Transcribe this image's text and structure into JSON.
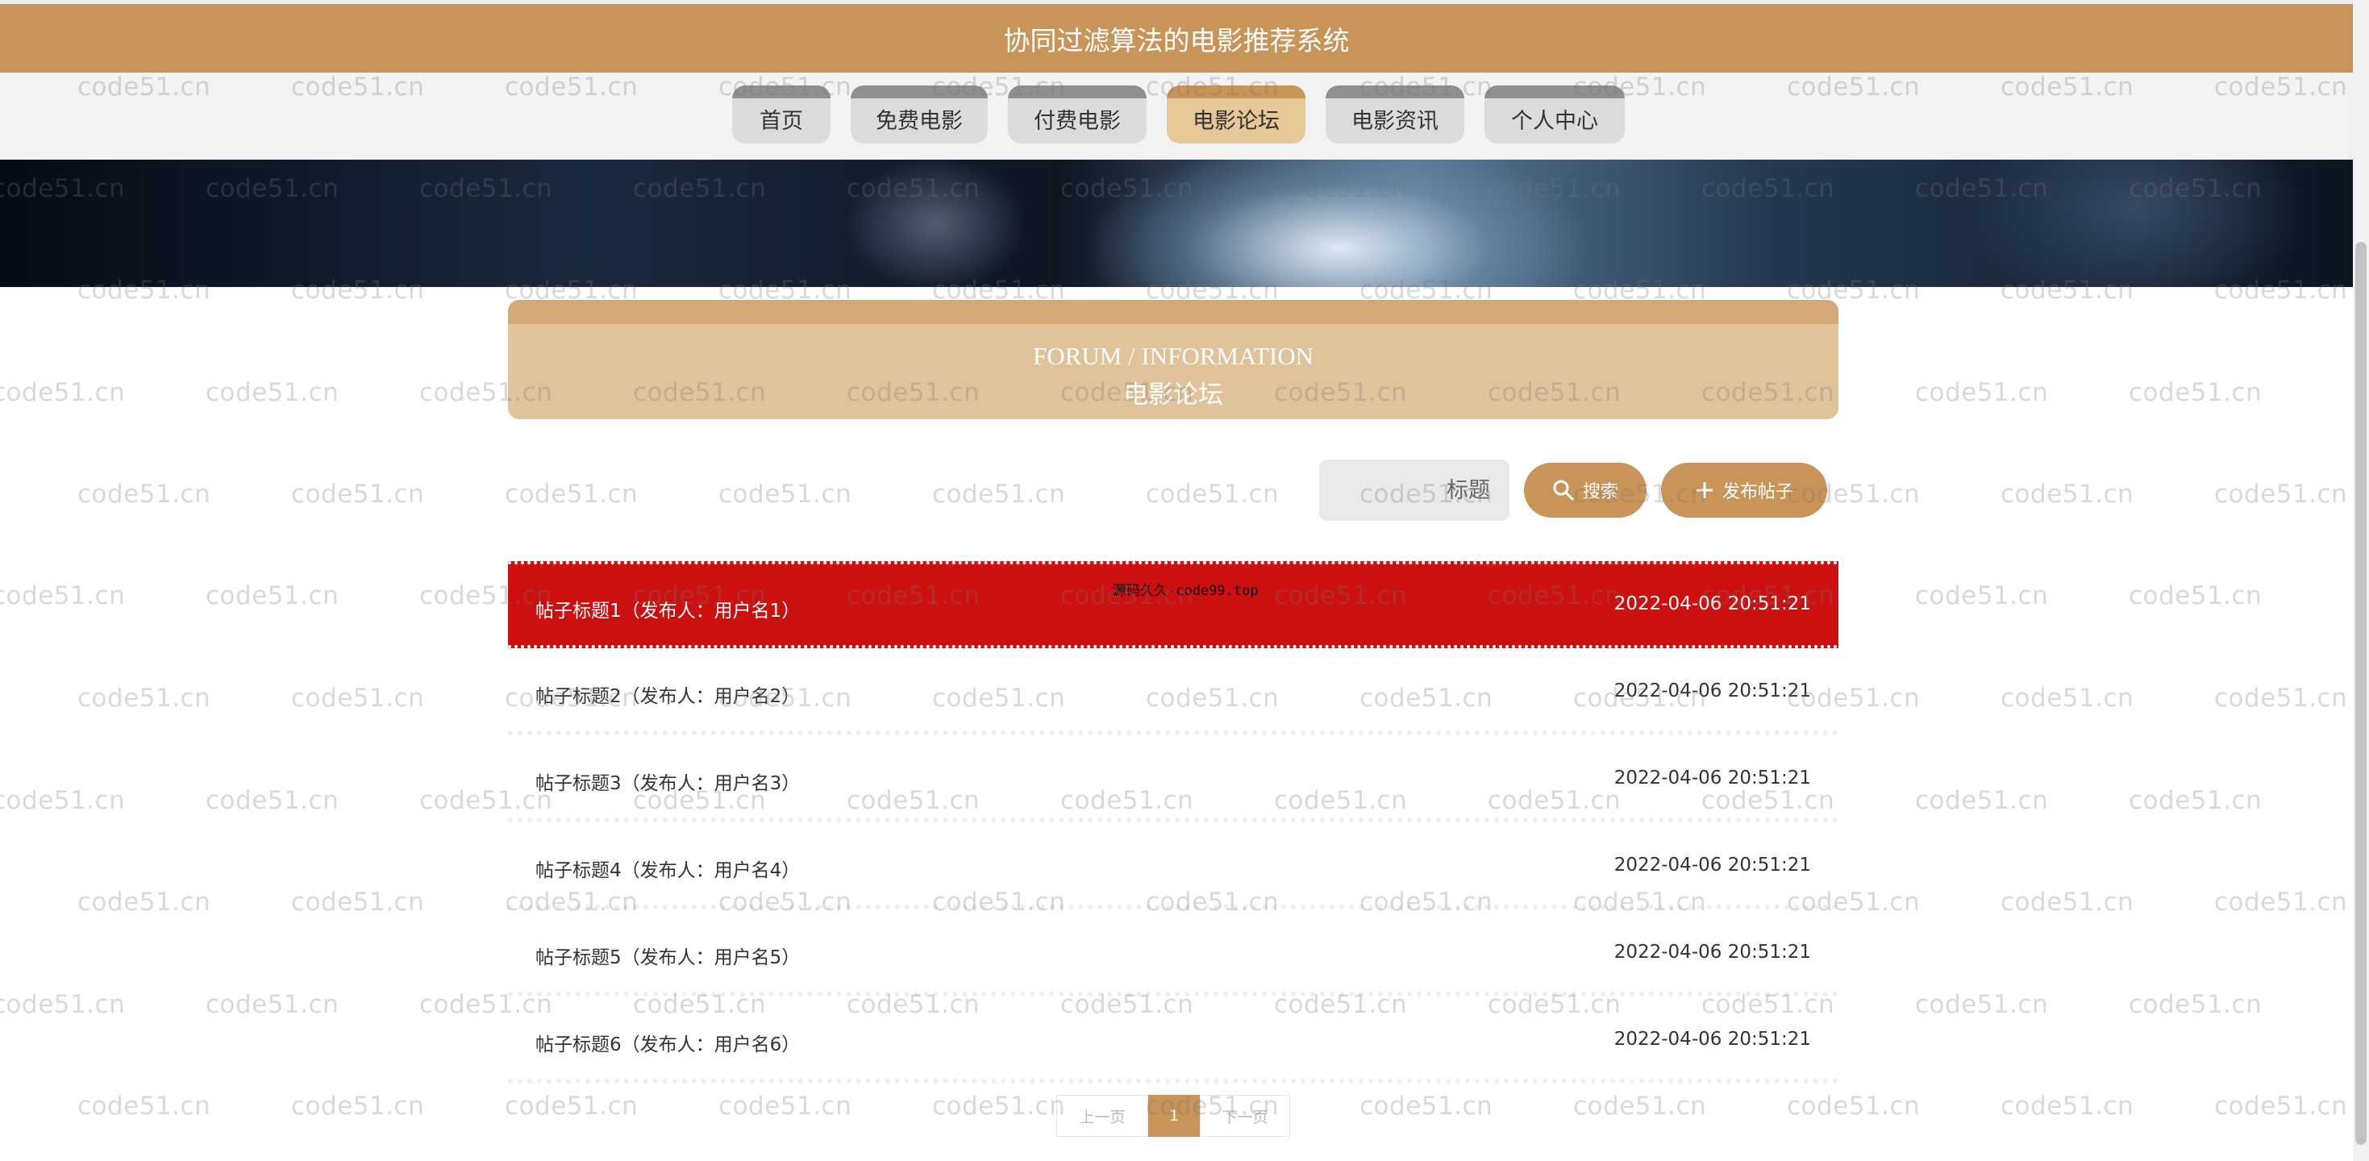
{
  "header": {
    "title": "协同过滤算法的电影推荐系统"
  },
  "nav": {
    "items": [
      {
        "label": "首页"
      },
      {
        "label": "免费电影"
      },
      {
        "label": "付费电影"
      },
      {
        "label": "电影论坛",
        "active": true
      },
      {
        "label": "电影资讯"
      },
      {
        "label": "个人中心"
      }
    ]
  },
  "section": {
    "title_en": "FORUM / INFORMATION",
    "title_cn": "电影论坛"
  },
  "search": {
    "placeholder": "标题",
    "search_label": "搜索",
    "search_icon": "search-icon",
    "publish_label": "发布帖子",
    "publish_icon": "plus-icon"
  },
  "posts": [
    {
      "title": "帖子标题1（发布人：用户名1）",
      "time": "2022-04-06 20:51:21"
    },
    {
      "title": "帖子标题2（发布人：用户名2）",
      "time": "2022-04-06 20:51:21"
    },
    {
      "title": "帖子标题3（发布人：用户名3）",
      "time": "2022-04-06 20:51:21"
    },
    {
      "title": "帖子标题4（发布人：用户名4）",
      "time": "2022-04-06 20:51:21"
    },
    {
      "title": "帖子标题5（发布人：用户名5）",
      "time": "2022-04-06 20:51:21"
    },
    {
      "title": "帖子标题6（发布人：用户名6）",
      "time": "2022-04-06 20:51:21"
    }
  ],
  "overlay_text": "源码久久-code99.top",
  "pagination": {
    "prev": "上一页",
    "current": "1",
    "next": "下一页"
  },
  "watermark": "code51.cn",
  "colors": {
    "accent": "#c99458",
    "accent_light": "#e0c39a",
    "hover_row": "#cc0f0f"
  }
}
